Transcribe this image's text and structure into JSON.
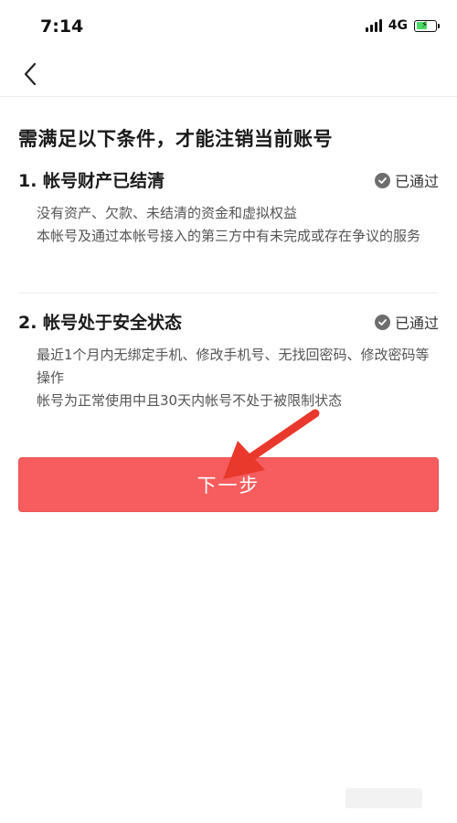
{
  "status_bar": {
    "time": "7:14",
    "network": "4G",
    "battery_level": 0.62,
    "battery_charging": true,
    "battery_color": "#4cd964"
  },
  "nav": {
    "back_icon": "chevron-left-icon"
  },
  "page": {
    "title": "需满足以下条件，才能注销当前账号"
  },
  "conditions": [
    {
      "title": "1. 帐号财产已结清",
      "status": "已通过",
      "status_icon": "check-circle-icon",
      "lines": [
        "没有资产、欠款、未结清的资金和虚拟权益",
        "本帐号及通过本帐号接入的第三方中有未完成或存在争议的服务"
      ]
    },
    {
      "title": "2. 帐号处于安全状态",
      "status": "已通过",
      "status_icon": "check-circle-icon",
      "lines": [
        "最近1个月内无绑定手机、修改手机号、无找回密码、修改密码等操作",
        "帐号为正常使用中且30天内帐号不处于被限制状态"
      ]
    }
  ],
  "next_button": {
    "label": "下一步",
    "color": "#f75c5e"
  },
  "annotation": {
    "arrow_icon": "red-arrow-icon",
    "color": "#e8392c"
  }
}
